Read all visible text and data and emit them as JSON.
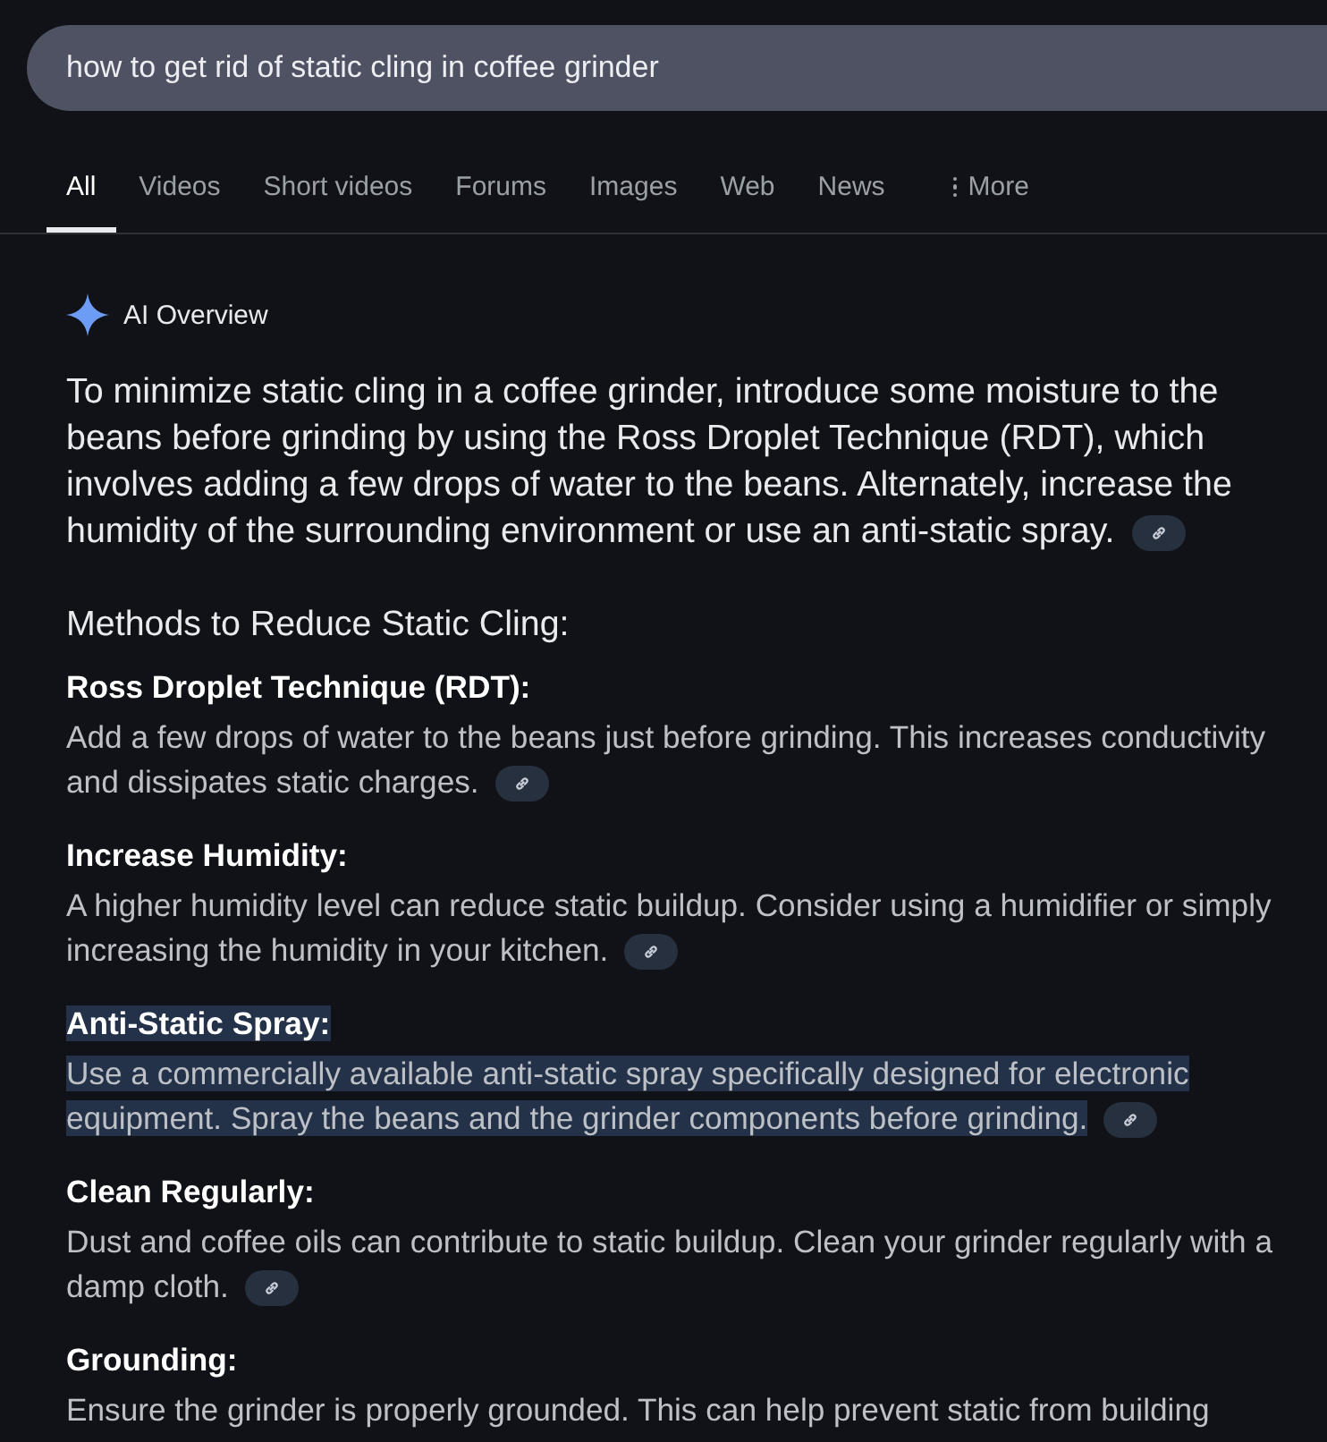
{
  "search": {
    "value": "how to get rid of static cling in coffee grinder"
  },
  "tabs": [
    {
      "label": "All",
      "selected": true,
      "kind": "tab"
    },
    {
      "label": "Videos",
      "selected": false,
      "kind": "tab"
    },
    {
      "label": "Short videos",
      "selected": false,
      "kind": "tab"
    },
    {
      "label": "Forums",
      "selected": false,
      "kind": "tab"
    },
    {
      "label": "Images",
      "selected": false,
      "kind": "tab"
    },
    {
      "label": "Web",
      "selected": false,
      "kind": "tab"
    },
    {
      "label": "News",
      "selected": false,
      "kind": "tab"
    },
    {
      "label": "More",
      "selected": false,
      "kind": "menu"
    }
  ],
  "overview": {
    "label": "AI Overview",
    "summary": "To minimize static cling in a coffee grinder, introduce some moisture to the beans before grinding by using the Ross Droplet Technique (RDT), which involves adding a few drops of water to the beans. Alternately, increase the humidity of the surrounding environment or use an anti-static spray.",
    "summary_link": true,
    "methods_heading": "Methods to Reduce Static Cling:",
    "methods": [
      {
        "title": "Ross Droplet Technique (RDT):",
        "text": "Add a few drops of water to the beans just before grinding. This increases conductivity and dissipates static charges.",
        "link": true,
        "highlighted": false
      },
      {
        "title": "Increase Humidity:",
        "text": "A higher humidity level can reduce static buildup. Consider using a humidifier or simply increasing the humidity in your kitchen.",
        "link": true,
        "highlighted": false
      },
      {
        "title": "Anti-Static Spray:",
        "text": "Use a commercially available anti-static spray specifically designed for electronic equipment. Spray the beans and the grinder components before grinding.",
        "link": true,
        "highlighted": true
      },
      {
        "title": "Clean Regularly:",
        "text": "Dust and coffee oils can contribute to static buildup. Clean your grinder regularly with a damp cloth.",
        "link": true,
        "highlighted": false
      },
      {
        "title": "Grounding:",
        "text": "Ensure the grinder is properly grounded. This can help prevent static from building",
        "link": false,
        "highlighted": false
      }
    ]
  }
}
